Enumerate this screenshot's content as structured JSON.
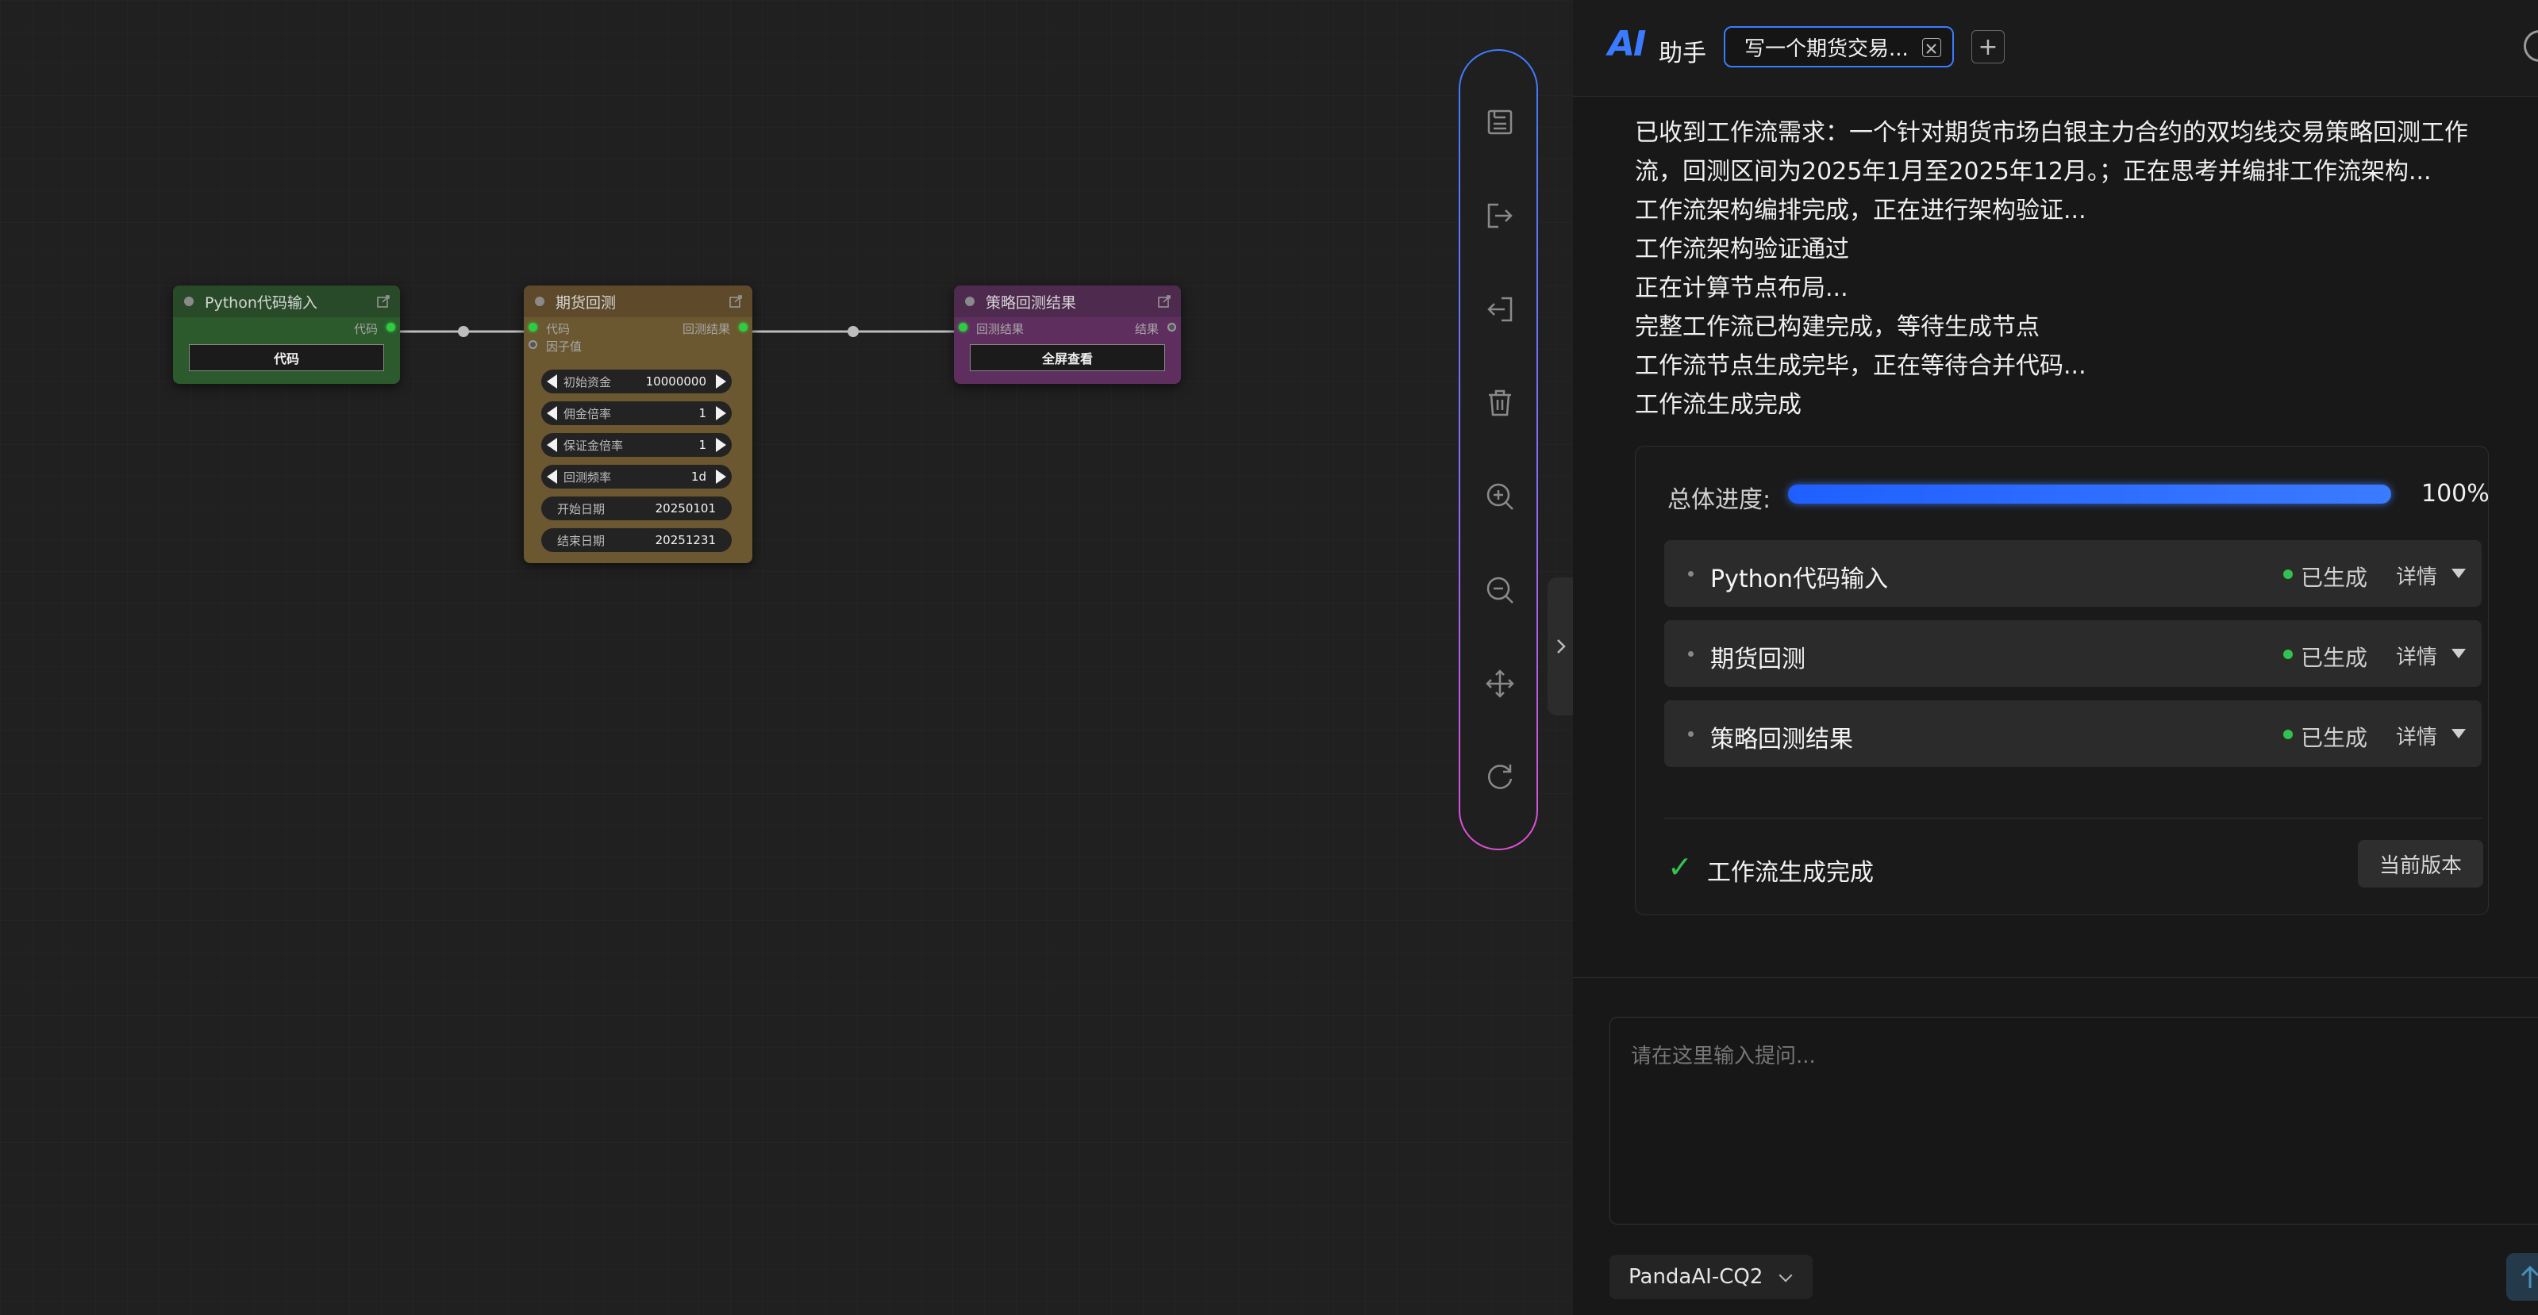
{
  "canvas": {
    "nodes": {
      "python_input": {
        "title": "Python代码输入",
        "output_label": "代码",
        "button": "代码"
      },
      "futures_backtest": {
        "title": "期货回测",
        "input_code": "代码",
        "input_factor": "因子值",
        "output_label": "回测结果",
        "widgets": [
          {
            "label": "初始资金",
            "value": "10000000"
          },
          {
            "label": "佣金倍率",
            "value": "1"
          },
          {
            "label": "保证金倍率",
            "value": "1"
          },
          {
            "label": "回测频率",
            "value": "1d"
          },
          {
            "label": "开始日期",
            "value": "20250101"
          },
          {
            "label": "结束日期",
            "value": "20251231"
          }
        ]
      },
      "strategy_result": {
        "title": "策略回测结果",
        "input_label": "回测结果",
        "output_label": "结果",
        "button": "全屏查看"
      }
    },
    "colors": {
      "python_node": "#2f5a2f",
      "backtest_node": "#6b5a33",
      "result_node": "#5a2f5a",
      "port_active": "#2ecc40"
    }
  },
  "toolbar": {
    "icons": [
      "save-icon",
      "export-icon",
      "import-icon",
      "delete-icon",
      "zoom-in-icon",
      "zoom-out-icon",
      "move-icon",
      "refresh-icon"
    ]
  },
  "ai_panel": {
    "logo": "AI",
    "title": "助手",
    "active_tab": "写一个期货交易...",
    "add_tab_symbol": "+",
    "messages": [
      "已收到工作流需求：一个针对期货市场白银主力合约的双均线交易策略回测工作",
      "流，回测区间为2025年1月至2025年12月。；正在思考并编排工作流架构...",
      "工作流架构编排完成，正在进行架构验证...",
      "工作流架构验证通过",
      "正在计算节点布局...",
      "完整工作流已构建完成，等待生成节点",
      "工作流节点生成完毕，正在等待合并代码...",
      "工作流生成完成"
    ],
    "progress": {
      "label": "总体进度:",
      "percent": 100,
      "percent_text": "100%",
      "steps": [
        {
          "name": "Python代码输入",
          "status": "已生成",
          "detail": "详情"
        },
        {
          "name": "期货回测",
          "status": "已生成",
          "detail": "详情"
        },
        {
          "name": "策略回测结果",
          "status": "已生成",
          "detail": "详情"
        }
      ],
      "done_check": "✓",
      "done_text": "工作流生成完成",
      "version_button": "当前版本"
    },
    "prompt": {
      "placeholder": "请在这里输入提问..."
    },
    "model": "PandaAI-CQ2",
    "accent": "#3b7bff"
  }
}
